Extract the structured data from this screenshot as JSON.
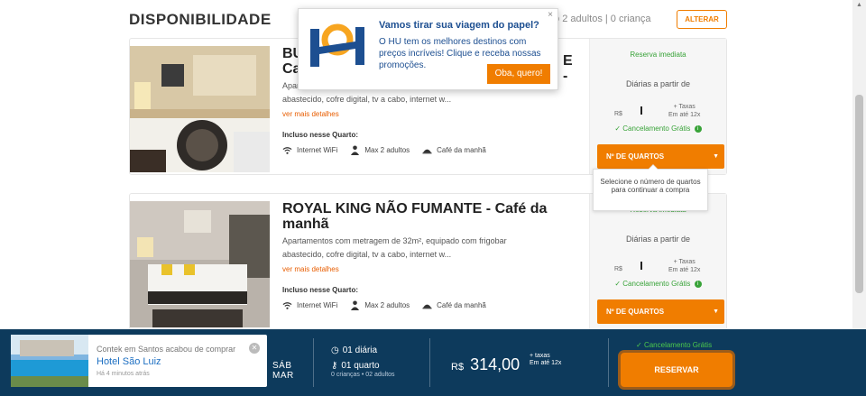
{
  "header": {
    "title": "DISPONIBILIDADE",
    "summary": "2 adultos  |  0 criança",
    "summary_prefix": "o",
    "alter_label": "ALTERAR"
  },
  "rooms": [
    {
      "name_visible": "BU",
      "name_line2": "Ca",
      "name_tail": "E -",
      "desc_line1": "Apar",
      "desc_line2": "abastecido, cofre digital, tv a cabo, internet w...",
      "more_label": "ver mais detalhes",
      "included_title": "Incluso nesse Quarto:",
      "amenities": [
        "Internet WiFi",
        "Max 2 adultos",
        "Café da manhã"
      ],
      "reserve_label": "Reserva imediata",
      "daily_label": "Diárias a partir de",
      "currency": "R$",
      "tax_note": "+ Taxas\nEm até 12x",
      "cancel_label": "Cancelamento Grátis",
      "rooms_select_label": "Nº DE QUARTOS"
    },
    {
      "name_visible": "ROYAL KING NÃO FUMANTE - Café da manhã",
      "desc_line1": "Apartamentos com metragem de 32m², equipado com frigobar",
      "desc_line2": "abastecido, cofre digital, tv a cabo, internet w...",
      "more_label": "ver mais detalhes",
      "included_title": "Incluso nesse Quarto:",
      "amenities": [
        "Internet WiFi",
        "Max 2 adultos",
        "Café da manhã"
      ],
      "reserve_label": "Reserva imediata",
      "daily_label": "Diárias a partir de",
      "currency": "R$",
      "tax_note": "+ Taxas\nEm até 12x",
      "cancel_label": "Cancelamento Grátis",
      "rooms_select_label": "Nº DE QUARTOS"
    }
  ],
  "tooltip": {
    "text": "Selecione o número de quartos para continuar a compra"
  },
  "promo": {
    "title": "Vamos tirar sua viagem do papel?",
    "body": "O HU tem os melhores destinos com preços incríveis! Clique e receba nossas promoções.",
    "cta": "Oba, quero!",
    "close": "×"
  },
  "booking_bar": {
    "notif_text": "Contek em Santos acabou de comprar",
    "notif_hotel": "Hotel São Luiz",
    "notif_time": "Há 4 minutos atrás",
    "day": "SÁB",
    "month": "MAR",
    "nights": "01 diária",
    "rooms": "01 quarto",
    "guests": "0 crianças • 02 adultos",
    "currency": "R$",
    "total": "314,00",
    "tax_note": "+ taxas\nEm até 12x",
    "cancel_label": "Cancelamento Grátis",
    "reserve_button": "RESERVAR"
  },
  "colors": {
    "accent": "#f07d00",
    "navy": "#0d3a5c",
    "green": "#39a339",
    "brand_blue": "#1d4f91"
  }
}
